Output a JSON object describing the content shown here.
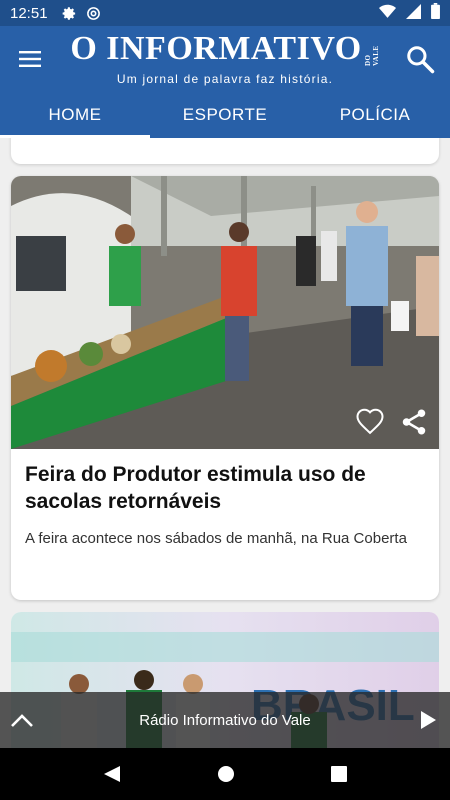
{
  "status_bar": {
    "time": "12:51",
    "icons": [
      "gear-icon",
      "at-sign-icon",
      "wifi-icon",
      "signal-icon",
      "battery-icon"
    ]
  },
  "app_bar": {
    "logo_main": "O INFORMATIVO",
    "logo_small": "DO VALE",
    "tagline": "Um jornal de palavra faz história.",
    "menu_icon": "hamburger-menu-icon",
    "search_icon": "search-icon",
    "color": "#2860a8"
  },
  "tabs": [
    {
      "label": "HOME",
      "active": true
    },
    {
      "label": "ESPORTE",
      "active": false
    },
    {
      "label": "POLÍCIA",
      "active": false
    }
  ],
  "articles": [
    {
      "title": "Feira do Produtor estimula uso de sacolas retornáveis",
      "description": "A feira acontece nos sábados de manhã, na Rua Coberta",
      "like_icon": "heart-outline-icon",
      "share_icon": "share-icon"
    }
  ],
  "next_article_image_text": "BRASIL",
  "player": {
    "title": "Rádio Informativo do Vale",
    "expand_icon": "chevron-up-icon",
    "play_icon": "play-icon"
  },
  "nav_bar": {
    "icons": [
      "back-icon",
      "home-icon",
      "recents-icon"
    ]
  }
}
